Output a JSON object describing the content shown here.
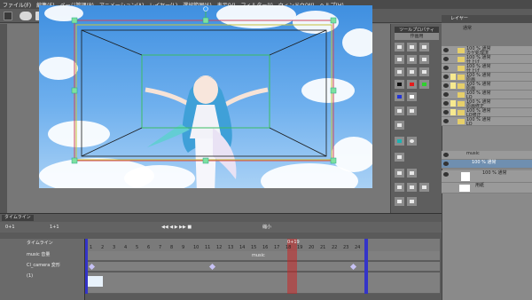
{
  "menu": {
    "items": [
      "ファイル(F)",
      "編集(E)",
      "ページ管理(P)",
      "アニメーション(A)",
      "レイヤー(L)",
      "選択範囲(S)",
      "表示(V)",
      "フィルター(I)",
      "ウィンドウ(W)",
      "ヘルプ(H)"
    ]
  },
  "tool_palette": {
    "header": "ツールプロパティ",
    "title": "作画用"
  },
  "layer_panel": {
    "header": "レイヤー",
    "blend_mode": "通常",
    "layers": [
      {
        "name": "100 % 通常",
        "sub": "カゲ処理済",
        "tag": "",
        "folder": true
      },
      {
        "name": "100 % 通常",
        "sub": "仕上げ",
        "tag": "",
        "folder": true
      },
      {
        "name": "100 % 通常",
        "sub": "仕上げ",
        "tag": "",
        "folder": true
      },
      {
        "name": "100 % 通常",
        "sub": "原画",
        "tag": "#f6e98f",
        "folder": true
      },
      {
        "name": "100 % 通常",
        "sub": "原画",
        "tag": "#f6e98f",
        "folder": true
      },
      {
        "name": "100 % 通常",
        "sub": "LO",
        "tag": "",
        "folder": true
      },
      {
        "name": "100 % 通常",
        "sub": "原画修正",
        "tag": "#f6e98f",
        "folder": true
      },
      {
        "name": "100 % 通常",
        "sub": "LO修正",
        "tag": "#f6e98f",
        "folder": true
      },
      {
        "name": "100 % 通常",
        "sub": "LO",
        "tag": "",
        "folder": true
      },
      {
        "name": "music",
        "sub": "",
        "tag": "",
        "folder": false
      },
      {
        "name": "100 % 通常",
        "sub": "",
        "tag": "",
        "folder": false
      },
      {
        "name": "100 % 通常",
        "sub": "",
        "tag": "",
        "folder": false
      },
      {
        "name": "用紙",
        "sub": "",
        "tag": "",
        "folder": false
      }
    ]
  },
  "timeline": {
    "tab": "タイムライン",
    "frame_current": "0+1",
    "frame_field": "1+1",
    "zoom_label": "縮小",
    "ruler_label": "タイムライン",
    "playhead_label": "0+19",
    "track_labels": [
      "music 音量",
      "Cl_camera 変形",
      "(1)"
    ],
    "track_audio_label": "music",
    "frame_numbers": [
      "1",
      "2",
      "3",
      "4",
      "5",
      "6",
      "7",
      "8",
      "9",
      "10",
      "11",
      "12",
      "13",
      "14",
      "15",
      "16",
      "17",
      "18",
      "19",
      "20",
      "21",
      "22",
      "23",
      "24"
    ]
  }
}
